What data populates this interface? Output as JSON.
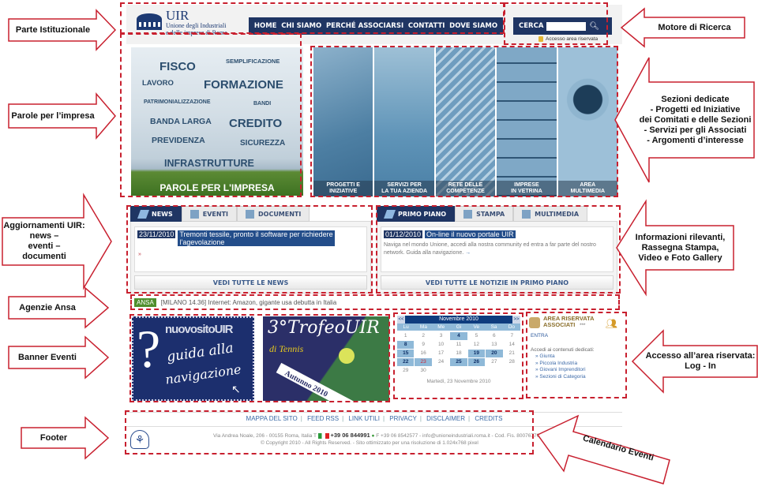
{
  "callouts": {
    "left": [
      {
        "id": "parte-istituzionale",
        "text": "Parte Istituzionale"
      },
      {
        "id": "parole-impresa",
        "text": "Parole per l’impresa"
      },
      {
        "id": "aggiornamenti",
        "text": "Aggiornamenti UIR:\nnews –\neventi –\ndocumenti"
      },
      {
        "id": "agenzie-ansa",
        "text": "Agenzie Ansa"
      },
      {
        "id": "banner-eventi",
        "text": "Banner Eventi"
      },
      {
        "id": "footer",
        "text": "Footer"
      }
    ],
    "right": [
      {
        "id": "motore-ricerca",
        "text": "Motore di Ricerca"
      },
      {
        "id": "sezioni-dedicate",
        "text": "Sezioni dedicate\n- Progetti ed Iniziative\ndei Comitati e delle Sezioni\n- Servizi per gli Associati\n- Argomenti d’interesse"
      },
      {
        "id": "informazioni",
        "text": "Informazioni rilevanti,\nRassegna Stampa,\nVideo e Foto Gallery"
      },
      {
        "id": "accesso-area",
        "text": "Accesso all’area riservata:\nLog - In"
      },
      {
        "id": "calendario",
        "text": "Calendario Eventi"
      }
    ]
  },
  "site": {
    "logo": {
      "name": "UIR",
      "subtitle_1": "Unione degli Industriali",
      "subtitle_2": "e delle imprese di Roma"
    },
    "nav": [
      "HOME",
      "CHI SIAMO",
      "PERCHÉ ASSOCIARSI",
      "CONTATTI",
      "DOVE SIAMO"
    ],
    "search": {
      "label": "CERCA",
      "value": "",
      "placeholder": ""
    },
    "reserved_link": "Accesso area riservata",
    "parole": {
      "words": [
        "FISCO",
        "SEMPLIFICAZIONE",
        "LAVORO",
        "FORMAZIONE",
        "PATRIMONIALIZZAZIONE",
        "BANDI",
        "BANDA LARGA",
        "CREDITO",
        "PREVIDENZA",
        "SICUREZZA",
        "INFRASTRUTTURE"
      ],
      "caption": "PAROLE PER L'IMPRESA"
    },
    "sections": [
      {
        "l1": "PROGETTI E",
        "l2": "INIZIATIVE"
      },
      {
        "l1": "SERVIZI PER",
        "l2": "LA TUA AZIENDA"
      },
      {
        "l1": "RETE DELLE",
        "l2": "COMPETENZE"
      },
      {
        "l1": "IMPRESE",
        "l2": "IN VETRINA"
      },
      {
        "l1": "AREA",
        "l2": "MULTIMEDIA"
      }
    ],
    "news_box": {
      "tabs": [
        "NEWS",
        "EVENTI",
        "DOCUMENTI"
      ],
      "active_tab": "NEWS",
      "date": "23/11/2010",
      "headline_1": "Tremonti tessile, pronto il software per richiedere",
      "headline_2": "l’agevolazione",
      "more": "VEDI TUTTE LE NEWS"
    },
    "primo_box": {
      "tabs": [
        "PRIMO PIANO",
        "STAMPA",
        "MULTIMEDIA"
      ],
      "active_tab": "PRIMO PIANO",
      "date": "01/12/2010",
      "headline": "On-line il nuovo portale UIR",
      "body": "Naviga nel mondo Unione, accedi alla nostra community ed entra a far parte del nostro network. Guida alla navigazione.",
      "more": "VEDI TUTTE LE NOTIZIE IN PRIMO PIANO"
    },
    "ansa": {
      "badge": "ANSA",
      "text": "[MILANO 14.36] Internet: Amazon, gigante usa debutta in Italia"
    },
    "banners": {
      "b1": {
        "title": "nuovositoUIR",
        "line1": "guida alla",
        "line2": "navigazione"
      },
      "b2": {
        "title": "3°TrofeoUIR",
        "sub": "di Tennis",
        "date": "Autunno 2010"
      }
    },
    "calendar": {
      "month": "Novembre 2010",
      "prev": "<<",
      "next": ">>",
      "days": [
        "Lu",
        "Ma",
        "Me",
        "Gi",
        "Ve",
        "Sa",
        "Do"
      ],
      "event_days": [
        4,
        8,
        15,
        19,
        20,
        22,
        25,
        26
      ],
      "today": 23,
      "num_days": 30,
      "first_weekday": 0,
      "footer": "Martedì, 23 Novembre 2010"
    },
    "reserved": {
      "title_1": "AREA RISERVATA",
      "title_2": "ASSOCIATI",
      "stars": "***",
      "entra": "ENTRA",
      "intro": "Accedi ai contenuti dedicati:",
      "items": [
        "» Giunta",
        "» Piccola Industria",
        "» Giovani Imprenditori",
        "» Sezioni di Categoria"
      ]
    },
    "footer": {
      "links": [
        "MAPPA DEL SITO",
        "FEED RSS",
        "LINK UTILI",
        "PRIVACY",
        "DISCLAIMER",
        "CREDITS"
      ],
      "address": "Via Andrea Noale, 206 - 00155 Roma, Italia T",
      "phone": "+39 06 844991",
      "contact": "F +39 06 8542577 - info@unioneindustriali.roma.it - Cod. Fis. 80076770587",
      "copyright": "© Copyright 2010 - All Rights Reserved. - Sito ottimizzato per una risoluzione di 1.024x768 pixel"
    }
  },
  "colors": {
    "accent_red": "#c8202f",
    "nav_blue": "#1f3563",
    "link_blue": "#3a6aa5"
  }
}
